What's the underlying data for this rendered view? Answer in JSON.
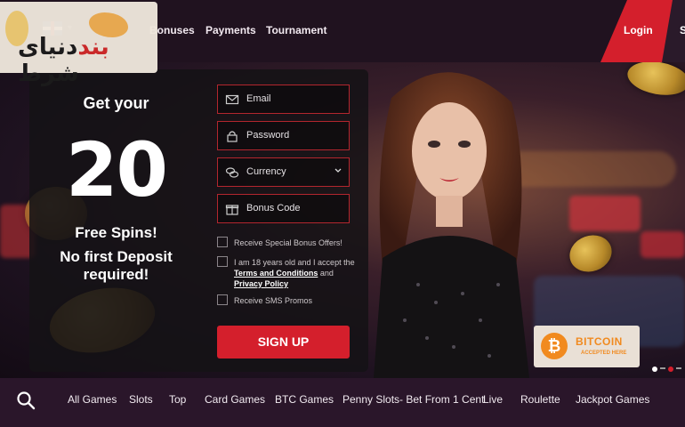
{
  "header": {
    "logo_text_dark": "دنیای شرط",
    "logo_text_red": "بند",
    "nav": [
      "Bonuses",
      "Payments",
      "Tournament"
    ],
    "login_label": "Login",
    "signup_label": "S"
  },
  "promo": {
    "line1": "Get your",
    "amount": "20",
    "line2": "Free Spins!",
    "line3": "No first Deposit required!"
  },
  "form": {
    "email_placeholder": "Email",
    "password_placeholder": "Password",
    "currency_placeholder": "Currency",
    "bonus_placeholder": "Bonus Code",
    "check_offers": "Receive Special Bonus Offers!",
    "check_age_pre": "I am 18 years old and I accept the",
    "terms_link": "Terms and Conditions",
    "and_text": " and ",
    "privacy_link": "Privacy Policy",
    "check_sms": "Receive SMS Promos",
    "signup_button": "SIGN UP"
  },
  "bitcoin": {
    "symbol": "₿",
    "title": "BITCOIN",
    "subtitle": "ACCEPTED HERE"
  },
  "bottom_nav": [
    "All Games",
    "Slots",
    "Top",
    "Card Games",
    "BTC Games",
    "Penny Slots- Bet From 1 Cent",
    "Live",
    "Roulette",
    "Jackpot Games"
  ],
  "colors": {
    "accent_red": "#d41f2c",
    "bitcoin_orange": "#f18a1f",
    "header_bg": "#20121f"
  }
}
